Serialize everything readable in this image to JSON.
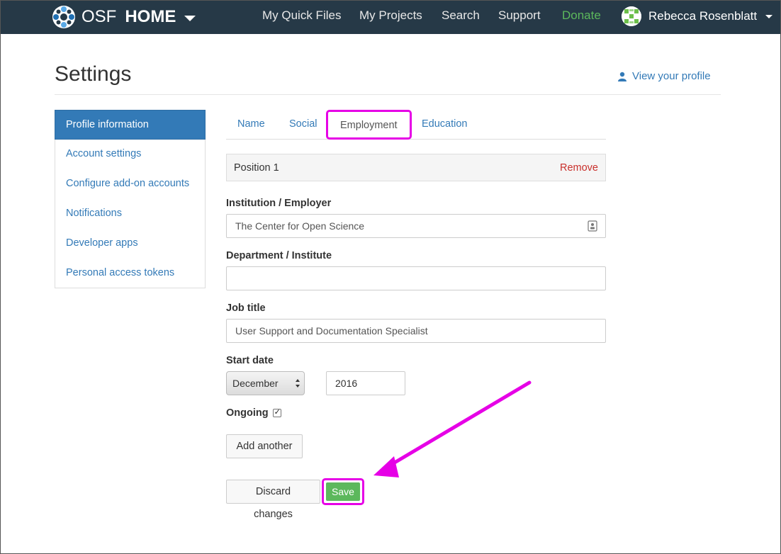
{
  "navbar": {
    "brand_light": "OSF",
    "brand_bold": "HOME",
    "links": [
      "My Quick Files",
      "My Projects",
      "Search",
      "Support",
      "Donate"
    ],
    "user_name": "Rebecca Rosenblatt",
    "bg_color": "#263947",
    "donate_color": "#5cb85c"
  },
  "page": {
    "title": "Settings",
    "view_profile": "View your profile"
  },
  "sidebar": {
    "items": [
      {
        "label": "Profile information",
        "active": true
      },
      {
        "label": "Account settings"
      },
      {
        "label": "Configure add-on accounts"
      },
      {
        "label": "Notifications"
      },
      {
        "label": "Developer apps"
      },
      {
        "label": "Personal access tokens"
      }
    ]
  },
  "tabs": [
    "Name",
    "Social",
    "Employment",
    "Education"
  ],
  "form": {
    "position_title": "Position 1",
    "remove_label": "Remove",
    "institution_label": "Institution / Employer",
    "institution_value": "The Center for Open Science",
    "department_label": "Department / Institute",
    "department_value": "",
    "job_title_label": "Job title",
    "job_title_value": "User Support and Documentation Specialist",
    "start_date_label": "Start date",
    "start_month": "December",
    "start_year": "2016",
    "ongoing_label": "Ongoing",
    "ongoing_checked": true,
    "add_another": "Add another",
    "discard": "Discard changes",
    "save": "Save"
  },
  "annotation_color": "#e600e6"
}
